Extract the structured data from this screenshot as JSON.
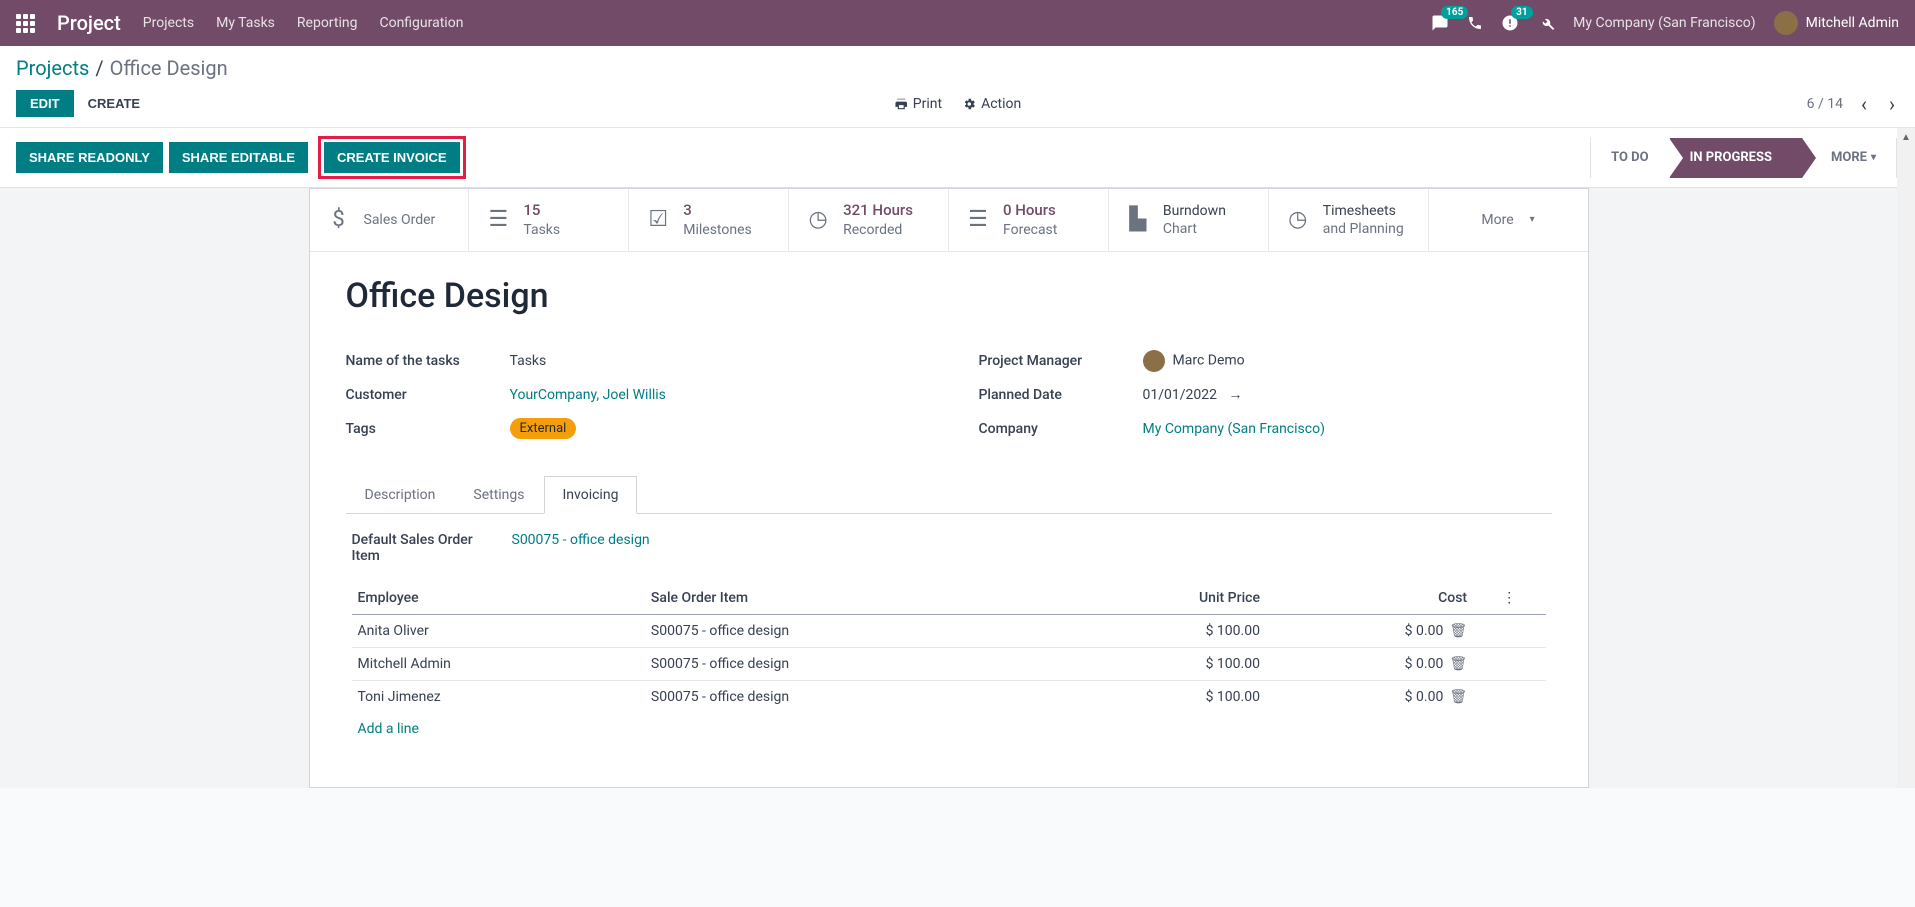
{
  "nav": {
    "brand": "Project",
    "items": [
      "Projects",
      "My Tasks",
      "Reporting",
      "Configuration"
    ],
    "msg_count": "165",
    "activity_count": "31",
    "company": "My Company (San Francisco)",
    "user": "Mitchell Admin"
  },
  "breadcrumb": {
    "parent": "Projects",
    "current": "Office Design"
  },
  "actions": {
    "edit": "EDIT",
    "create": "CREATE",
    "print": "Print",
    "action": "Action",
    "pager": "6 / 14"
  },
  "status": {
    "share_ro": "SHARE READONLY",
    "share_ed": "SHARE EDITABLE",
    "create_inv": "CREATE INVOICE",
    "todo": "TO DO",
    "inprogress": "IN PROGRESS",
    "more": "MORE"
  },
  "stats": {
    "sales": {
      "label": "Sales Order"
    },
    "tasks": {
      "num": "15",
      "label": "Tasks"
    },
    "milestones": {
      "num": "3",
      "label": "Milestones"
    },
    "recorded": {
      "num": "321 Hours",
      "label": "Recorded"
    },
    "forecast": {
      "num": "0 Hours",
      "label": "Forecast"
    },
    "burndown": {
      "num": "Burndown",
      "label": "Chart"
    },
    "timesheets": {
      "num": "Timesheets",
      "label": "and Planning"
    },
    "more": "More"
  },
  "form": {
    "title": "Office Design",
    "labels": {
      "name_tasks": "Name of the tasks",
      "customer": "Customer",
      "tags": "Tags",
      "pm": "Project Manager",
      "planned": "Planned Date",
      "company": "Company"
    },
    "values": {
      "name_tasks": "Tasks",
      "customer": "YourCompany, Joel Willis",
      "tag": "External",
      "pm": "Marc Demo",
      "planned": "01/01/2022",
      "company": "My Company (San Francisco)"
    }
  },
  "tabs": {
    "desc": "Description",
    "settings": "Settings",
    "invoicing": "Invoicing"
  },
  "invoicing": {
    "dso_label": "Default Sales Order Item",
    "dso_value": "S00075 - office design",
    "cols": {
      "emp": "Employee",
      "soi": "Sale Order Item",
      "up": "Unit Price",
      "cost": "Cost"
    },
    "rows": [
      {
        "emp": "Anita Oliver",
        "soi": "S00075 - office design",
        "up": "$ 100.00",
        "cost": "$ 0.00"
      },
      {
        "emp": "Mitchell Admin",
        "soi": "S00075 - office design",
        "up": "$ 100.00",
        "cost": "$ 0.00"
      },
      {
        "emp": "Toni Jimenez",
        "soi": "S00075 - office design",
        "up": "$ 100.00",
        "cost": "$ 0.00"
      }
    ],
    "addline": "Add a line"
  }
}
